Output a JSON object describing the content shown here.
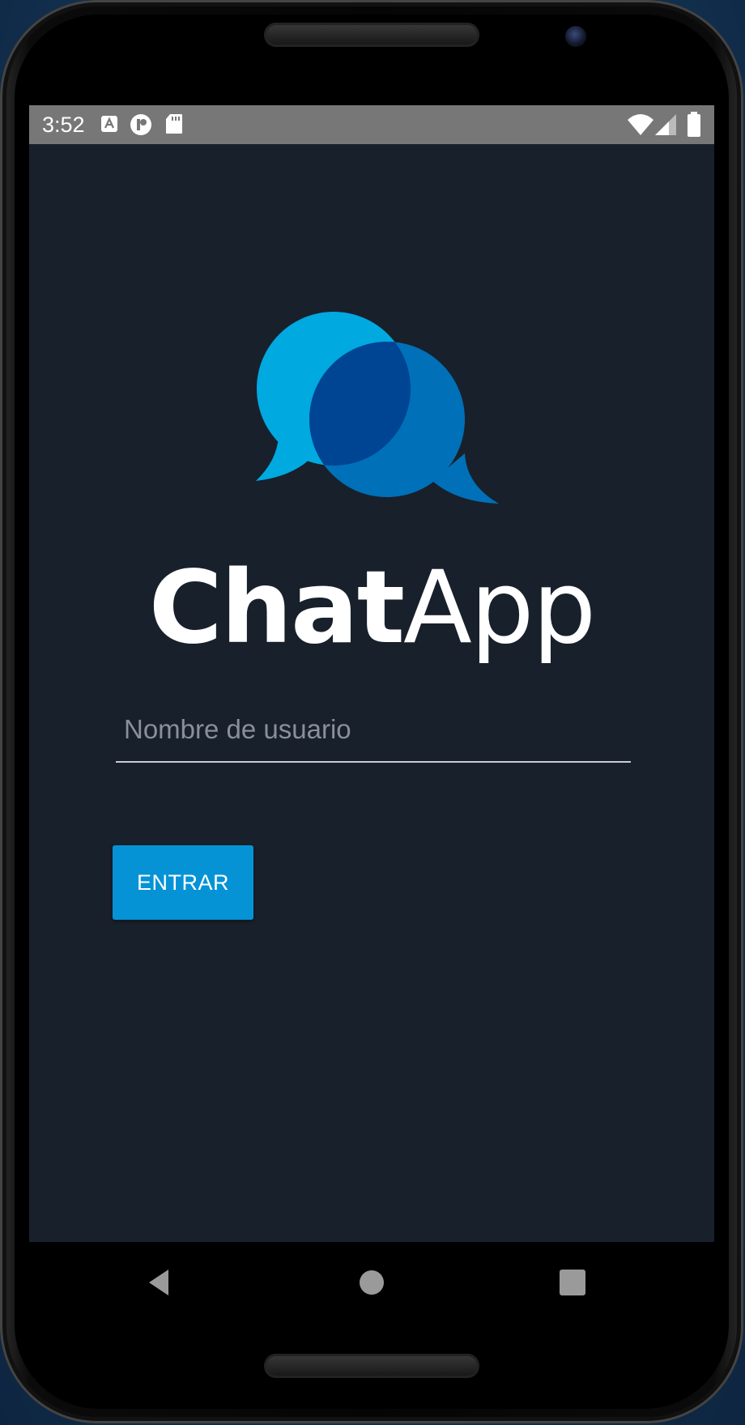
{
  "status_bar": {
    "time": "3:52",
    "left_icons": [
      "text-a-notification-icon",
      "lens-notification-icon",
      "sd-card-icon"
    ],
    "right_icons": [
      "wifi-icon",
      "cellular-signal-icon",
      "battery-icon"
    ]
  },
  "app": {
    "title_part1": "Chat",
    "title_part2": "App",
    "logo": "chat-bubbles-logo",
    "colors": {
      "background": "#18202b",
      "bubble_light": "#00a9e0",
      "bubble_dark": "#0070b8",
      "bubble_overlap": "#004494",
      "button": "#0593d6"
    }
  },
  "form": {
    "username_placeholder": "Nombre de usuario",
    "username_value": "",
    "enter_label": "ENTRAR"
  },
  "nav_bar": {
    "buttons": [
      "back-icon",
      "home-icon",
      "recents-icon"
    ]
  }
}
